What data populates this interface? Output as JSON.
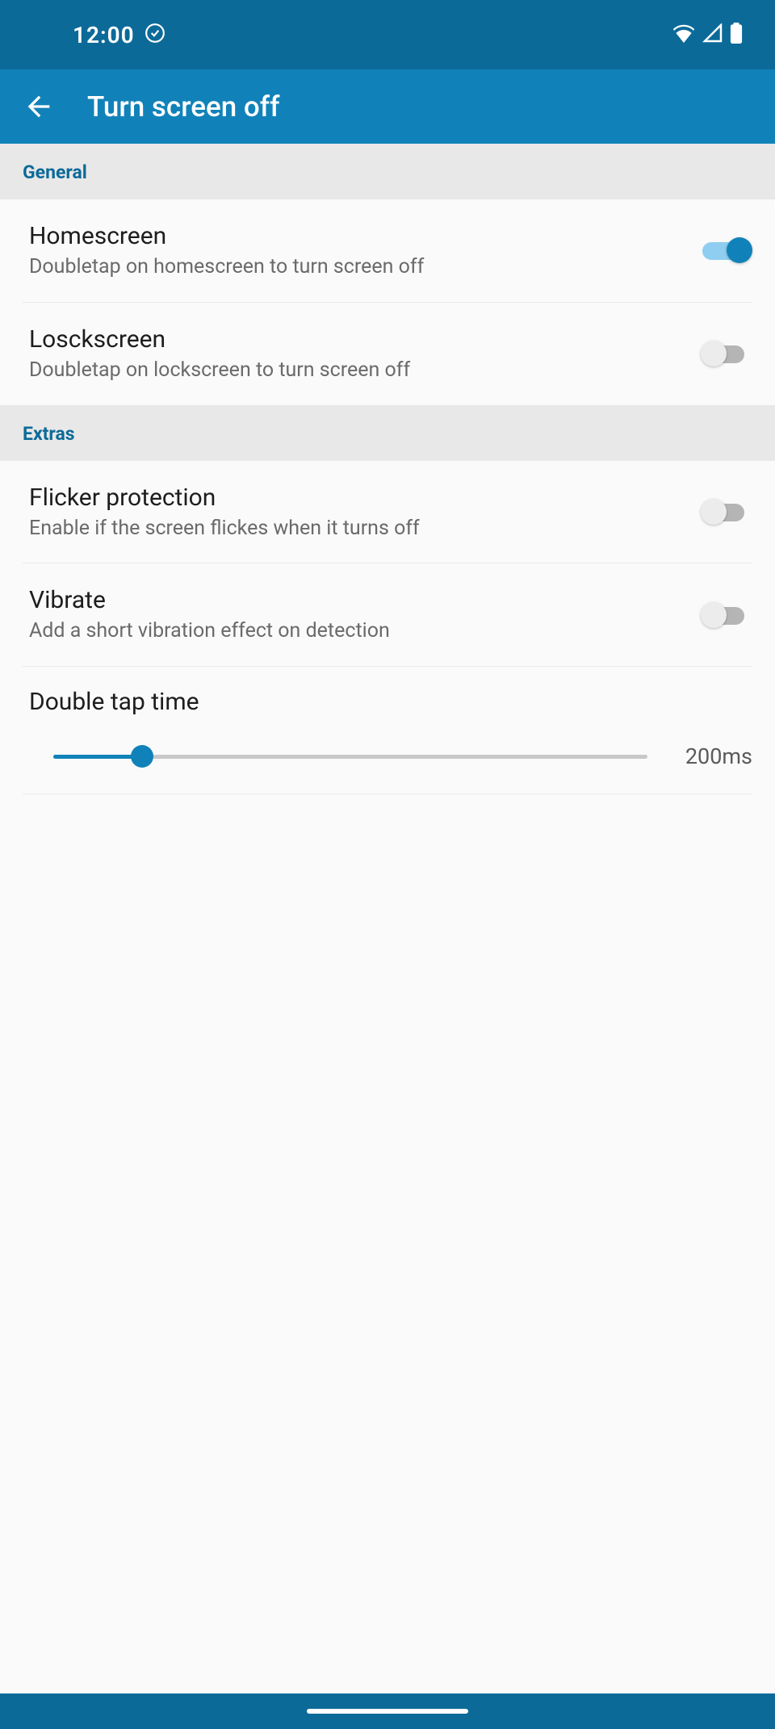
{
  "status": {
    "time": "12:00"
  },
  "appbar": {
    "title": "Turn screen off"
  },
  "sections": {
    "general": {
      "header": "General",
      "homescreen": {
        "title": "Homescreen",
        "subtitle": "Doubletap on homescreen to turn screen off",
        "on": true
      },
      "lockscreen": {
        "title": "Losckscreen",
        "subtitle": "Doubletap on lockscreen to turn screen off",
        "on": false
      }
    },
    "extras": {
      "header": "Extras",
      "flicker": {
        "title": "Flicker protection",
        "subtitle": "Enable if the screen flickes when it turns off",
        "on": false
      },
      "vibrate": {
        "title": "Vibrate",
        "subtitle": "Add a short vibration effect on detection",
        "on": false
      },
      "doubletap": {
        "title": "Double tap time",
        "value_label": "200ms",
        "percent": 15
      }
    }
  }
}
